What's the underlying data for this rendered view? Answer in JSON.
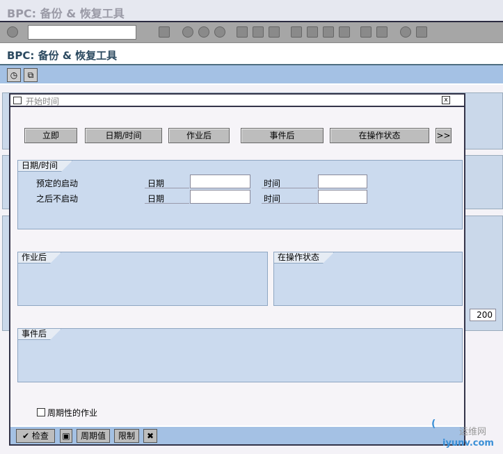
{
  "window_title": "BPC: 备份 & 恢复工具",
  "toolbar": {
    "command_value": ""
  },
  "app_title": "BPC: 备份 & 恢复工具",
  "background_field": "200",
  "dialog": {
    "title": "开始时间",
    "buttons": [
      "立即",
      "日期/时间",
      "作业后",
      "事件后",
      "在操作状态",
      ">>"
    ],
    "datetime_group": {
      "label": "日期/时间",
      "row1_label": "预定的启动",
      "row2_label": "之后不启动",
      "date_label": "日期",
      "time_label": "时间",
      "date1": "",
      "time1": "",
      "date2": "",
      "time2": ""
    },
    "after_job_group": "作业后",
    "op_mode_group": "在操作状态",
    "after_event_group": "事件后",
    "periodic_checkbox": "周期性的作业",
    "footer": {
      "check": "检查",
      "period": "周期值",
      "restrict": "限制"
    }
  },
  "watermark": {
    "cn": "运维网",
    "url": "iyunv.com"
  }
}
